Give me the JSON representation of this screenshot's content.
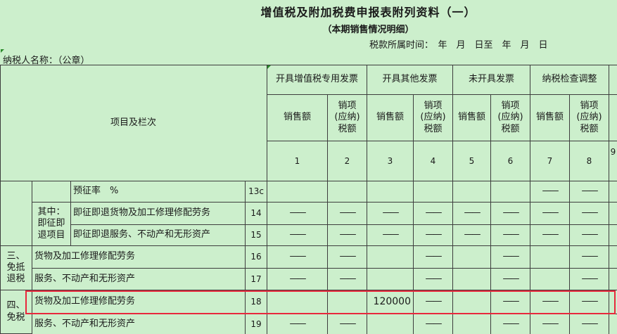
{
  "title": "增值税及附加税费申报表附列资料（一）",
  "subtitle": "（本期销售情况明细）",
  "period_label": "税款所属时间：　年　月　日至　年　月　日",
  "taxpayer_label": "纳税人名称：（公章）",
  "header": {
    "project_col": "项目及栏次",
    "groups": [
      "开具增值税专用发票",
      "开具其他发票",
      "未开具发票",
      "纳税检查调整"
    ],
    "sales_amount": "销售额",
    "output_tax": "销项(应纳)税额",
    "col_numbers": [
      "1",
      "2",
      "3",
      "4",
      "5",
      "6",
      "7",
      "8",
      "9"
    ]
  },
  "dash": "——",
  "rows": {
    "r13c": {
      "label": "预征率　%",
      "line": "13c"
    },
    "group_zhongji": "其中：即征即退项目",
    "r14": {
      "label": "即征即退货物及加工修理修配劳务",
      "line": "14"
    },
    "r15": {
      "label": "即征即退服务、不动产和无形资产",
      "line": "15"
    },
    "group_three": "三、免抵退税",
    "r16": {
      "label": "货物及加工修理修配劳务",
      "line": "16"
    },
    "r17": {
      "label": "服务、不动产和无形资产",
      "line": "17"
    },
    "group_four": "四、免税",
    "r18": {
      "label": "货物及加工修理修配劳务",
      "line": "18",
      "col3_value": "120000"
    },
    "r19": {
      "label": "服务、不动产和无形资产",
      "line": "19"
    }
  },
  "colors": {
    "background": "#ccefcc",
    "highlight": "#e8283c",
    "grid": "#3d3d3d"
  }
}
